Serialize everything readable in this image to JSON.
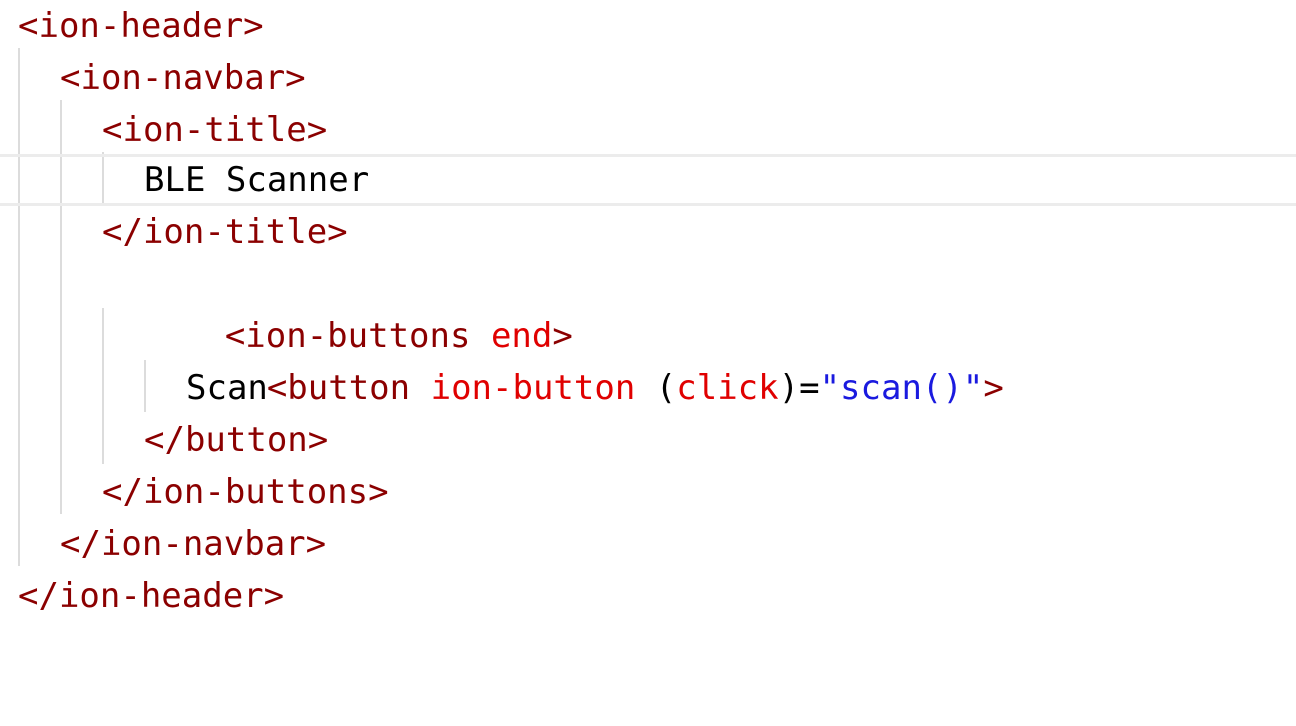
{
  "lines": [
    {
      "parts": [
        "<ion-header>"
      ]
    },
    {
      "parts": [
        "<ion-navbar>"
      ]
    },
    {
      "parts": [
        "<ion-title>"
      ]
    },
    {
      "parts": [
        "BLE Scanner"
      ]
    },
    {
      "parts": [
        "</ion-title>"
      ]
    },
    {
      "parts": [
        "<ion-buttons ",
        "end",
        ">"
      ]
    },
    {
      "parts": [
        "<button ",
        "ion-button",
        " (",
        "click",
        ")=",
        "\"scan()\"",
        ">"
      ]
    },
    {
      "parts": [
        "Scan"
      ]
    },
    {
      "parts": [
        "</button>"
      ]
    },
    {
      "parts": [
        "</ion-buttons>"
      ]
    },
    {
      "parts": [
        "</ion-navbar>"
      ]
    },
    {
      "parts": [
        "</ion-header>"
      ]
    }
  ],
  "colors": {
    "tag": "#8b0000",
    "attribute": "#e00000",
    "string": "#1a1adf",
    "text": "#000000",
    "current_line_border": "#ececec",
    "indent_guide": "#dcdcdc"
  }
}
